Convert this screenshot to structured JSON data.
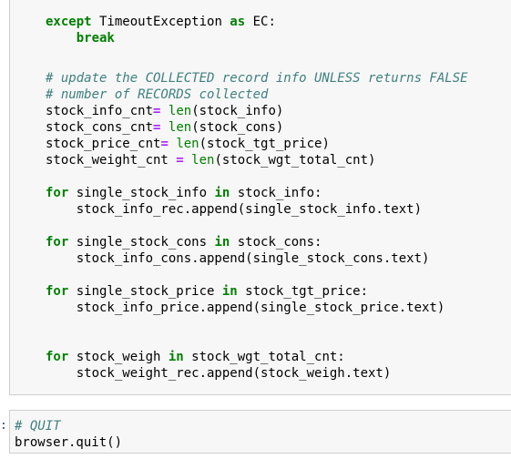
{
  "cells": [
    {
      "lines": [
        [
          {
            "t": "except",
            "c": "kw"
          },
          {
            "t": " TimeoutException "
          },
          {
            "t": "as",
            "c": "kw"
          },
          {
            "t": " EC:"
          }
        ],
        [
          {
            "t": "    "
          },
          {
            "t": "break",
            "c": "kw"
          }
        ],
        [],
        [
          {
            "t": "# update the COLLECTED record info UNLESS returns FALSE",
            "c": "cm"
          }
        ],
        [
          {
            "t": "# number of RECORDS collected",
            "c": "cm"
          }
        ],
        [
          {
            "t": "stock_info_cnt"
          },
          {
            "t": "=",
            "c": "op"
          },
          {
            "t": " "
          },
          {
            "t": "len",
            "c": "bi"
          },
          {
            "t": "(stock_info)"
          }
        ],
        [
          {
            "t": "stock_cons_cnt"
          },
          {
            "t": "=",
            "c": "op"
          },
          {
            "t": " "
          },
          {
            "t": "len",
            "c": "bi"
          },
          {
            "t": "(stock_cons)"
          }
        ],
        [
          {
            "t": "stock_price_cnt"
          },
          {
            "t": "=",
            "c": "op"
          },
          {
            "t": " "
          },
          {
            "t": "len",
            "c": "bi"
          },
          {
            "t": "(stock_tgt_price)"
          }
        ],
        [
          {
            "t": "stock_weight_cnt "
          },
          {
            "t": "=",
            "c": "op"
          },
          {
            "t": " "
          },
          {
            "t": "len",
            "c": "bi"
          },
          {
            "t": "(stock_wgt_total_cnt)"
          }
        ],
        [],
        [
          {
            "t": "for",
            "c": "kw"
          },
          {
            "t": " single_stock_info "
          },
          {
            "t": "in",
            "c": "kw"
          },
          {
            "t": " stock_info:"
          }
        ],
        [
          {
            "t": "    stock_info_rec.append(single_stock_info.text)"
          }
        ],
        [],
        [
          {
            "t": "for",
            "c": "kw"
          },
          {
            "t": " single_stock_cons "
          },
          {
            "t": "in",
            "c": "kw"
          },
          {
            "t": " stock_cons:"
          }
        ],
        [
          {
            "t": "    stock_info_cons.append(single_stock_cons.text)"
          }
        ],
        [],
        [
          {
            "t": "for",
            "c": "kw"
          },
          {
            "t": " single_stock_price "
          },
          {
            "t": "in",
            "c": "kw"
          },
          {
            "t": " stock_tgt_price:"
          }
        ],
        [
          {
            "t": "    stock_info_price.append(single_stock_price.text)"
          }
        ],
        [],
        [],
        [
          {
            "t": "for",
            "c": "kw"
          },
          {
            "t": " stock_weigh "
          },
          {
            "t": "in",
            "c": "kw"
          },
          {
            "t": " stock_wgt_total_cnt:"
          }
        ],
        [
          {
            "t": "    stock_weight_rec.append(stock_weigh.text)"
          }
        ]
      ]
    },
    {
      "lines": [
        [
          {
            "t": "# QUIT",
            "c": "cm"
          }
        ],
        [
          {
            "t": "browser.quit()"
          }
        ]
      ]
    }
  ],
  "prompt_marker": ":",
  "colors": {
    "keyword": "#008000",
    "builtin": "#008000",
    "operator": "#aa22ff",
    "comment": "#408080",
    "cell_background": "#f7f7f7",
    "cell_border": "#cfcfcf"
  }
}
